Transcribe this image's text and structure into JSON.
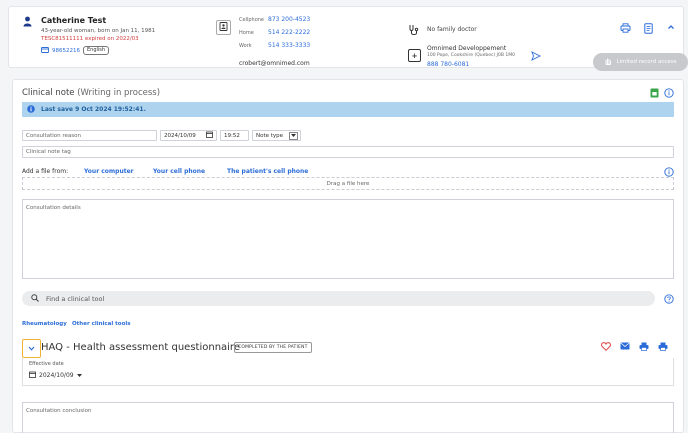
{
  "patient": {
    "name": "Catherine Test",
    "description": "43-year-old woman, born on Jan 11, 1981",
    "warning": "TESC81511111 expired on 2022/03",
    "hc_number": "98652216",
    "language": "English"
  },
  "contact": {
    "cellphone_label": "Cellphone",
    "cellphone": "873 200-4523",
    "home_label": "Home",
    "home": "514 222-2222",
    "work_label": "Work",
    "work": "514 333-3333",
    "email": "crobert@omnimed.com"
  },
  "doctor": {
    "text": "No family doctor"
  },
  "pharmacy": {
    "name": "Omnimed Developpement",
    "address": "100 Pope, Cookshire (Quebec) J0B 1M0",
    "phone": "888 780-6081"
  },
  "header_actions": {
    "limited_label": "Limited record access"
  },
  "note": {
    "title": "Clinical note",
    "subtitle": "(Writing in process)",
    "last_save": "Last save 9 Oct 2024 19:52:41.",
    "reason_placeholder": "Consultation reason",
    "date": "2024/10/09",
    "time": "19:52",
    "note_type_label": "Note type",
    "tag_placeholder": "Clinical note tag",
    "add_file_label": "Add a file from:",
    "file_sources": [
      "Your computer",
      "Your cell phone",
      "The patient's cell phone"
    ],
    "drag_label": "Drag a file here",
    "details_placeholder": "Consultation details",
    "search_placeholder": "Find a clinical tool",
    "tool_links": [
      "Rheumatology",
      "Other clinical tools"
    ],
    "conclusion_placeholder": "Consultation conclusion"
  },
  "haq": {
    "title": "HAQ - Health assessment questionnaire",
    "badge": "COMPLETED BY THE PATIENT",
    "effective_label": "Effective date",
    "effective_date": "2024/10/09"
  },
  "colors": {
    "accent": "#2b6cd8",
    "warning": "#d23c3c",
    "save_bar": "#aed3ef",
    "heart": "#e04646",
    "chevron_border": "#f0b232"
  }
}
